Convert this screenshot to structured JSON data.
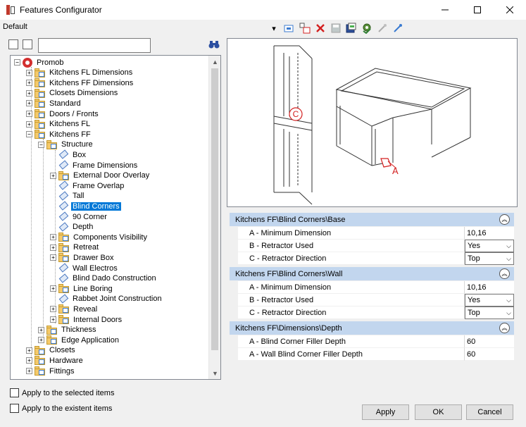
{
  "window": {
    "title": "Features Configurator",
    "minimize_icon": "minimize-icon",
    "maximize_icon": "maximize-icon",
    "close_icon": "close-icon"
  },
  "profile": {
    "selected": "Default"
  },
  "toolbar": {
    "buttons": [
      "dropdown-arrow-icon",
      "add-feature-icon",
      "add-group-icon",
      "delete-icon",
      "save-icon",
      "export-icon",
      "settings-icon",
      "expand-icon",
      "collapse-icon"
    ],
    "delete_color": "#d32020"
  },
  "search": {
    "value": "",
    "placeholder": ""
  },
  "tree": {
    "root": "Promob",
    "items": [
      {
        "label": "Kitchens FL Dimensions"
      },
      {
        "label": "Kitchens FF Dimensions"
      },
      {
        "label": "Closets Dimensions"
      },
      {
        "label": "Standard"
      },
      {
        "label": "Doors / Fronts"
      },
      {
        "label": "Kitchens FL"
      },
      {
        "label": "Kitchens FF"
      },
      {
        "label": "Structure"
      },
      {
        "label": "Box"
      },
      {
        "label": "Frame Dimensions"
      },
      {
        "label": "External Door Overlay"
      },
      {
        "label": "Frame Overlap"
      },
      {
        "label": "Tall"
      },
      {
        "label": "Blind Corners"
      },
      {
        "label": "90 Corner"
      },
      {
        "label": "Depth"
      },
      {
        "label": "Components Visibility"
      },
      {
        "label": "Retreat"
      },
      {
        "label": "Drawer Box"
      },
      {
        "label": "Wall Electros"
      },
      {
        "label": "Blind Dado Construction"
      },
      {
        "label": "Line Boring"
      },
      {
        "label": "Rabbet Joint Construction"
      },
      {
        "label": "Reveal"
      },
      {
        "label": "Internal Doors"
      },
      {
        "label": "Thickness"
      },
      {
        "label": "Edge Application"
      },
      {
        "label": "Closets"
      },
      {
        "label": "Hardware"
      },
      {
        "label": "Fittings"
      }
    ],
    "selected_color": "#0078d7"
  },
  "preview": {
    "label_a": "A",
    "label_c": "C",
    "accent": "#d32020"
  },
  "groups": [
    {
      "title": "Kitchens FF\\Blind Corners\\Base",
      "rows": [
        {
          "name": "A - Minimum Dimension",
          "value": "10,16"
        },
        {
          "name": "B - Retractor Used",
          "value": "Yes"
        },
        {
          "name": "C - Retractor Direction",
          "value": "Top"
        }
      ]
    },
    {
      "title": "Kitchens FF\\Blind Corners\\Wall",
      "rows": [
        {
          "name": "A - Minimum Dimension",
          "value": "10,16"
        },
        {
          "name": "B - Retractor Used",
          "value": "Yes"
        },
        {
          "name": "C - Retractor Direction",
          "value": "Top"
        }
      ]
    },
    {
      "title": "Kitchens FF\\Dimensions\\Depth",
      "rows": [
        {
          "name": "A - Blind Corner Filler Depth",
          "value": "60"
        },
        {
          "name": "A - Wall Blind Corner Filler Depth",
          "value": "60"
        }
      ]
    }
  ],
  "options": {
    "apply_selected": "Apply to the selected items",
    "apply_existent": "Apply to the existent items"
  },
  "buttons": {
    "apply": "Apply",
    "ok": "OK",
    "cancel": "Cancel"
  },
  "colors": {
    "group_header": "#c2d6ee"
  }
}
